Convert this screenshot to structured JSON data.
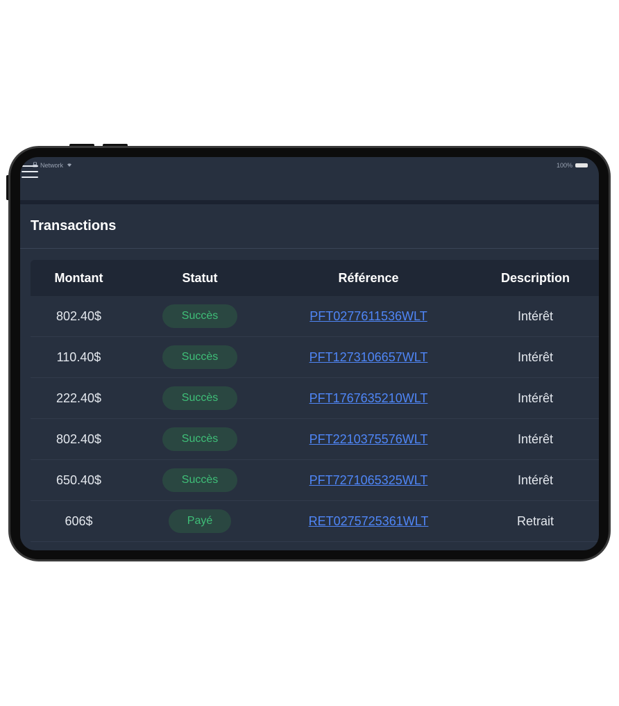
{
  "statusbar": {
    "network": "Network",
    "battery": "100%"
  },
  "page": {
    "title": "Transactions"
  },
  "table": {
    "headers": {
      "amount": "Montant",
      "status": "Statut",
      "reference": "Référence",
      "description": "Description"
    },
    "rows": [
      {
        "amount": "802.40$",
        "status": "Succès",
        "reference": "PFT0277611536WLT",
        "description": "Intérêt"
      },
      {
        "amount": "110.40$",
        "status": "Succès",
        "reference": "PFT1273106657WLT",
        "description": "Intérêt"
      },
      {
        "amount": "222.40$",
        "status": "Succès",
        "reference": "PFT1767635210WLT",
        "description": "Intérêt"
      },
      {
        "amount": "802.40$",
        "status": "Succès",
        "reference": "PFT2210375576WLT",
        "description": "Intérêt"
      },
      {
        "amount": "650.40$",
        "status": "Succès",
        "reference": "PFT7271065325WLT",
        "description": "Intérêt"
      },
      {
        "amount": "606$",
        "status": "Payé",
        "reference": "RET0275725361WLT",
        "description": "Retrait"
      }
    ]
  },
  "colors": {
    "screen_bg": "#27303f",
    "header_bg": "#1f2735",
    "badge_bg": "#2a4741",
    "badge_text": "#3fbf78",
    "link": "#4f86f7"
  },
  "icons": {
    "menu": "hamburger-menu-icon",
    "lock": "lock-icon",
    "wifi": "wifi-icon",
    "battery": "battery-icon"
  }
}
